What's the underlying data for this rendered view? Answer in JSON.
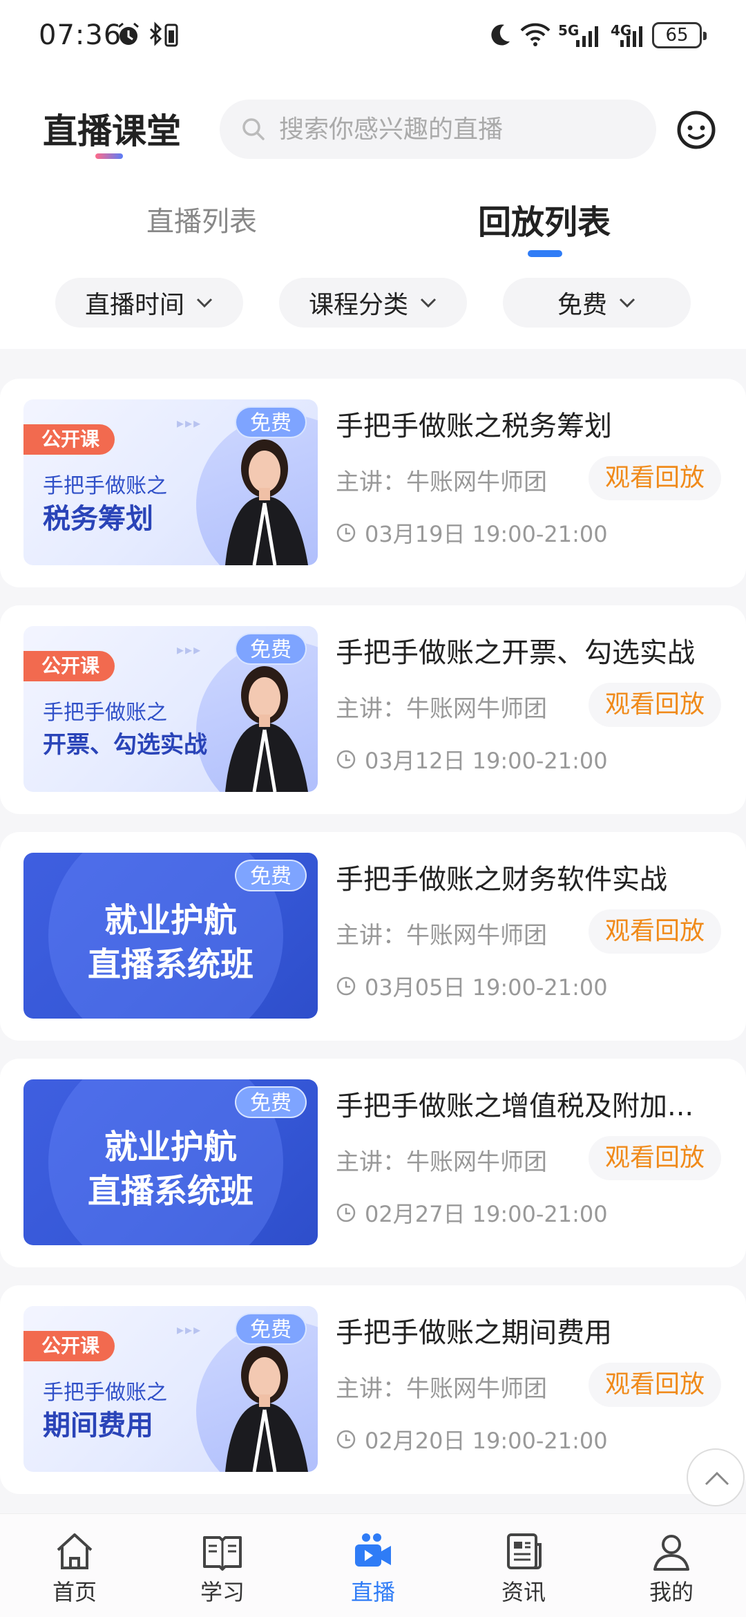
{
  "status_bar": {
    "time": "07:36",
    "network_5g": "5G",
    "network_4g": "4G",
    "battery": "65"
  },
  "header": {
    "title": "直播课堂",
    "search_placeholder": "搜索你感兴趣的直播"
  },
  "tabs": [
    {
      "label": "直播列表",
      "active": false
    },
    {
      "label": "回放列表",
      "active": true
    }
  ],
  "filters": [
    {
      "label": "直播时间"
    },
    {
      "label": "课程分类"
    },
    {
      "label": "免费"
    }
  ],
  "courses": [
    {
      "thumb_style": "teacher",
      "thumb_badge": "公开课",
      "thumb_subtitle": "手把手做账之",
      "thumb_main": "税务筹划",
      "price_badge": "免费",
      "title": "手把手做账之税务筹划",
      "speaker": "主讲：牛账网牛师团",
      "time": "03月19日 19:00-21:00",
      "action": "观看回放"
    },
    {
      "thumb_style": "teacher",
      "thumb_badge": "公开课",
      "thumb_subtitle": "手把手做账之",
      "thumb_main": "开票、勾选实战",
      "price_badge": "免费",
      "title": "手把手做账之开票、勾选实战",
      "speaker": "主讲：牛账网牛师团",
      "time": "03月12日 19:00-21:00",
      "action": "观看回放"
    },
    {
      "thumb_style": "banner",
      "thumb_line1": "就业护航",
      "thumb_line2": "直播系统班",
      "price_badge": "免费",
      "title": "手把手做账之财务软件实战",
      "speaker": "主讲：牛账网牛师团",
      "time": "03月05日 19:00-21:00",
      "action": "观看回放"
    },
    {
      "thumb_style": "banner",
      "thumb_line1": "就业护航",
      "thumb_line2": "直播系统班",
      "price_badge": "免费",
      "title": "手把手做账之增值税及附加...",
      "speaker": "主讲：牛账网牛师团",
      "time": "02月27日 19:00-21:00",
      "action": "观看回放"
    },
    {
      "thumb_style": "teacher",
      "thumb_badge": "公开课",
      "thumb_subtitle": "手把手做账之",
      "thumb_main": "期间费用",
      "price_badge": "免费",
      "title": "手把手做账之期间费用",
      "speaker": "主讲：牛账网牛师团",
      "time": "02月20日 19:00-21:00",
      "action": "观看回放"
    }
  ],
  "bottom_nav": [
    {
      "label": "首页",
      "icon": "home-icon",
      "active": false
    },
    {
      "label": "学习",
      "icon": "book-icon",
      "active": false
    },
    {
      "label": "直播",
      "icon": "live-camera-icon",
      "active": true
    },
    {
      "label": "资讯",
      "icon": "news-icon",
      "active": false
    },
    {
      "label": "我的",
      "icon": "profile-icon",
      "active": false
    }
  ],
  "colors": {
    "accent": "#2f7cf6",
    "action_orange": "#f08a1a",
    "badge_red": "#f26a4f",
    "banner_blue": "#3557d6"
  }
}
